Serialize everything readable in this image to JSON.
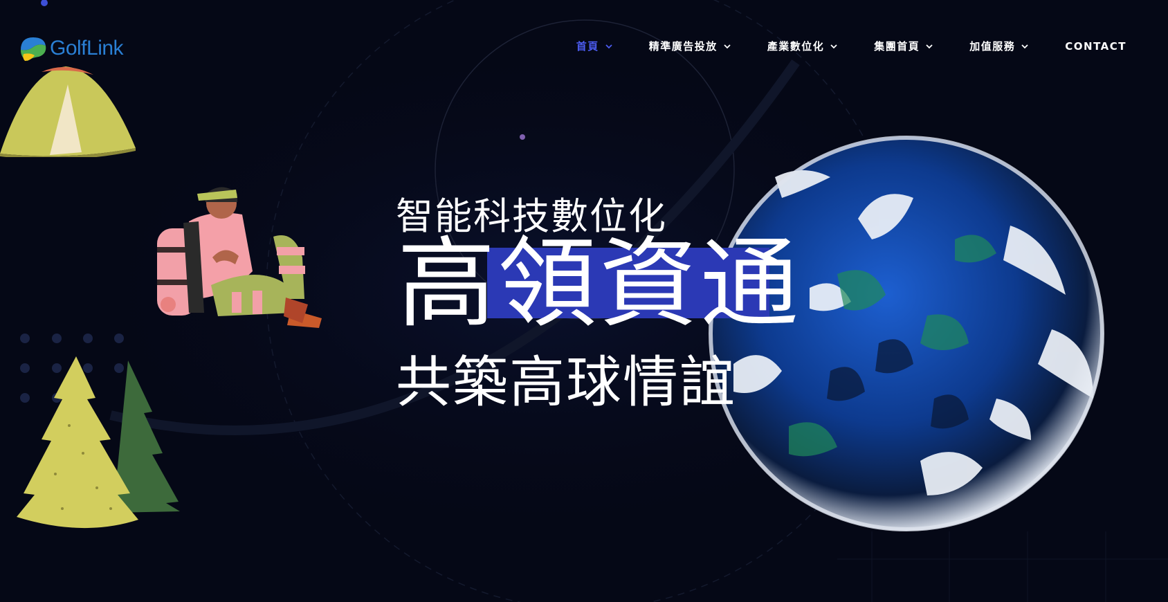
{
  "brand": {
    "name": "GolfLink",
    "icon": "golflink-logo-icon",
    "color": "#2a7fd4"
  },
  "nav": {
    "items": [
      {
        "label": "首頁",
        "has_dropdown": true,
        "active": true
      },
      {
        "label": "精準廣告投放",
        "has_dropdown": true,
        "active": false
      },
      {
        "label": "產業數位化",
        "has_dropdown": true,
        "active": false
      },
      {
        "label": "集團首頁",
        "has_dropdown": true,
        "active": false
      },
      {
        "label": "加值服務",
        "has_dropdown": true,
        "active": false
      },
      {
        "label": "CONTACT",
        "has_dropdown": false,
        "active": false
      }
    ],
    "active_color": "#4c5cf0"
  },
  "hero": {
    "line1": "智能科技數位化",
    "title": "高領資通",
    "line3": "共築高球情誼",
    "highlight_color": "#2b39b5"
  },
  "decor": {
    "icons": [
      "tent-icon",
      "hiker-illustration",
      "pine-trees-illustration",
      "glass-sphere-graphic",
      "dot-grid"
    ],
    "background_color": "#050816"
  }
}
